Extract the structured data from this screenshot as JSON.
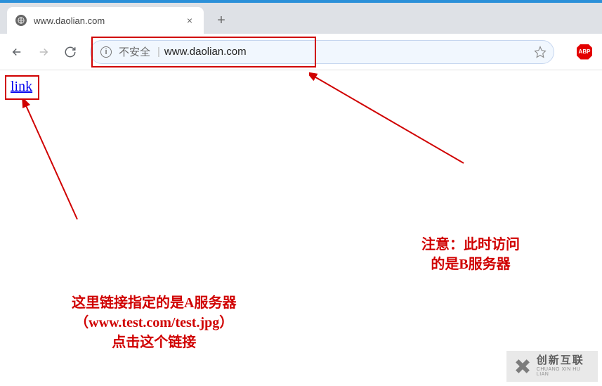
{
  "browser": {
    "tab_title": "www.daolian.com",
    "new_tab_label": "+",
    "close_tab_label": "×",
    "security_status": "不安全",
    "url": "www.daolian.com"
  },
  "page": {
    "link_label": "link"
  },
  "annotations": {
    "right": "注意：此时访问\n的是B服务器",
    "left": "这里链接指定的是A服务器\n（www.test.com/test.jpg）\n点击这个链接"
  },
  "watermark": {
    "cn": "创新互联",
    "en": "CHUANG XIN HU LIAN"
  },
  "extension": {
    "abp_label": "ABP"
  }
}
